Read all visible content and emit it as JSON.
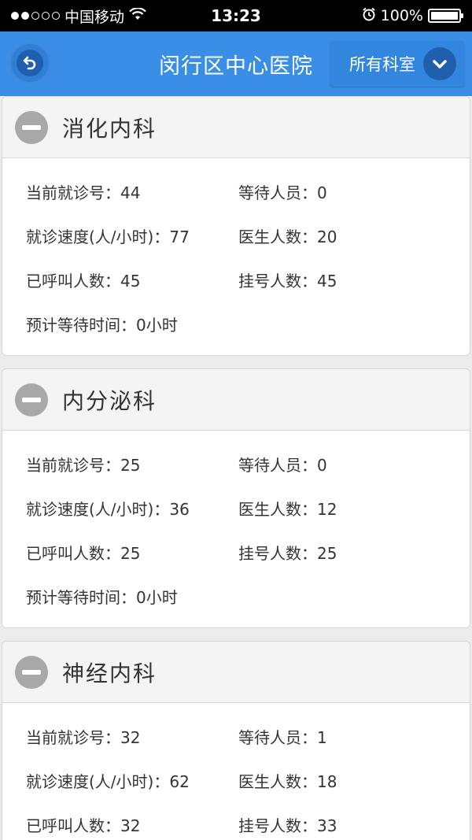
{
  "status_bar": {
    "carrier": "中国移动",
    "time": "13:23",
    "battery": "100%",
    "battery_level": 1.0,
    "signal_bars_filled": 2,
    "signal_bars_total": 5,
    "icons": [
      "signal-dots-icon",
      "wifi-icon",
      "alarm-icon",
      "battery-icon"
    ]
  },
  "navbar": {
    "back_icon": "back-arrow-icon",
    "title": "闵行区中心医院",
    "department_filter": "所有科室",
    "dropdown_icon": "chevron-down-icon",
    "colors": {
      "bar": "#3a8ee6",
      "button_dark": "#1f5fae"
    }
  },
  "departments": [
    {
      "name": "消化内科",
      "icon": "minus-circle-icon",
      "rows": [
        [
          "当前就诊号：44",
          "等待人员：0"
        ],
        [
          "就诊速度(人/小时)：77",
          "医生人数：20"
        ],
        [
          "已呼叫人数：45",
          "挂号人数：45"
        ],
        [
          "预计等待时间：0小时",
          ""
        ]
      ]
    },
    {
      "name": "内分泌科",
      "icon": "minus-circle-icon",
      "rows": [
        [
          "当前就诊号：25",
          "等待人员：0"
        ],
        [
          "就诊速度(人/小时)：36",
          "医生人数：12"
        ],
        [
          "已呼叫人数：25",
          "挂号人数：25"
        ],
        [
          "预计等待时间：0小时",
          ""
        ]
      ]
    },
    {
      "name": "神经内科",
      "icon": "minus-circle-icon",
      "rows": [
        [
          "当前就诊号：32",
          "等待人员：1"
        ],
        [
          "就诊速度(人/小时)：62",
          "医生人数：18"
        ],
        [
          "已呼叫人数：32",
          "挂号人数：33"
        ]
      ]
    }
  ]
}
